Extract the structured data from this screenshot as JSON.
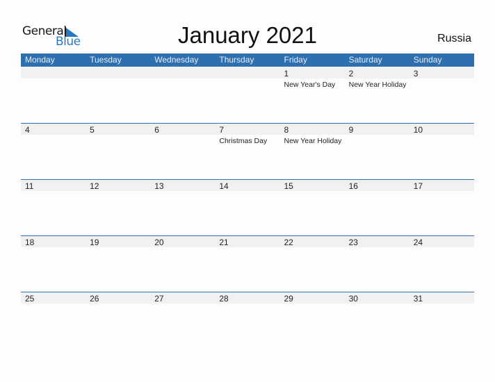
{
  "logo": {
    "line1": "General",
    "line2": "Blue"
  },
  "title": "January 2021",
  "country": "Russia",
  "colors": {
    "accent": "#2e6fb0",
    "date_strip": "#f1f1f1"
  },
  "weekdays": [
    "Monday",
    "Tuesday",
    "Wednesday",
    "Thursday",
    "Friday",
    "Saturday",
    "Sunday"
  ],
  "weeks": [
    [
      {
        "day": "",
        "holiday": ""
      },
      {
        "day": "",
        "holiday": ""
      },
      {
        "day": "",
        "holiday": ""
      },
      {
        "day": "",
        "holiday": ""
      },
      {
        "day": "1",
        "holiday": "New Year's Day"
      },
      {
        "day": "2",
        "holiday": "New Year Holiday"
      },
      {
        "day": "3",
        "holiday": ""
      }
    ],
    [
      {
        "day": "4",
        "holiday": ""
      },
      {
        "day": "5",
        "holiday": ""
      },
      {
        "day": "6",
        "holiday": ""
      },
      {
        "day": "7",
        "holiday": "Christmas Day"
      },
      {
        "day": "8",
        "holiday": "New Year Holiday"
      },
      {
        "day": "9",
        "holiday": ""
      },
      {
        "day": "10",
        "holiday": ""
      }
    ],
    [
      {
        "day": "11",
        "holiday": ""
      },
      {
        "day": "12",
        "holiday": ""
      },
      {
        "day": "13",
        "holiday": ""
      },
      {
        "day": "14",
        "holiday": ""
      },
      {
        "day": "15",
        "holiday": ""
      },
      {
        "day": "16",
        "holiday": ""
      },
      {
        "day": "17",
        "holiday": ""
      }
    ],
    [
      {
        "day": "18",
        "holiday": ""
      },
      {
        "day": "19",
        "holiday": ""
      },
      {
        "day": "20",
        "holiday": ""
      },
      {
        "day": "21",
        "holiday": ""
      },
      {
        "day": "22",
        "holiday": ""
      },
      {
        "day": "23",
        "holiday": ""
      },
      {
        "day": "24",
        "holiday": ""
      }
    ],
    [
      {
        "day": "25",
        "holiday": ""
      },
      {
        "day": "26",
        "holiday": ""
      },
      {
        "day": "27",
        "holiday": ""
      },
      {
        "day": "28",
        "holiday": ""
      },
      {
        "day": "29",
        "holiday": ""
      },
      {
        "day": "30",
        "holiday": ""
      },
      {
        "day": "31",
        "holiday": ""
      }
    ]
  ]
}
